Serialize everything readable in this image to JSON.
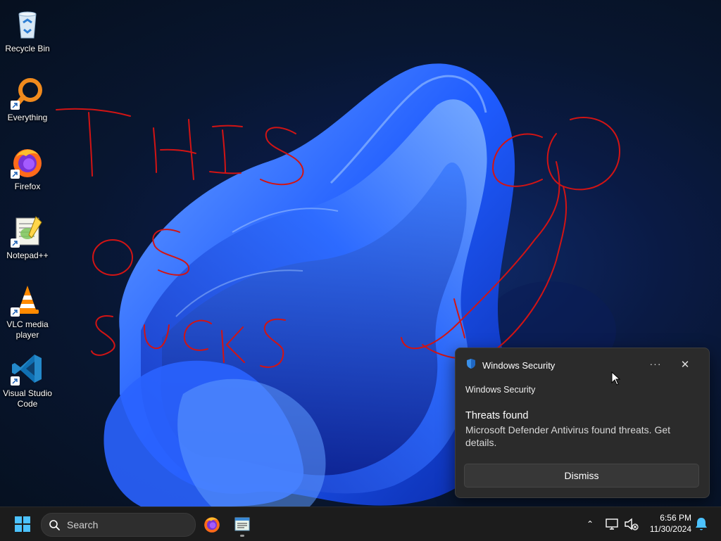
{
  "desktop": {
    "icons": [
      {
        "label": "Recycle Bin",
        "icon": "recycle-bin-icon"
      },
      {
        "label": "Everything",
        "icon": "everything-search-icon"
      },
      {
        "label": "Firefox",
        "icon": "firefox-icon"
      },
      {
        "label": "Notepad++",
        "icon": "notepad-plus-plus-icon"
      },
      {
        "label": "VLC media player",
        "icon": "vlc-icon"
      },
      {
        "label": "Visual Studio Code",
        "icon": "vscode-icon"
      }
    ],
    "scribble_text": [
      "THIS",
      "OS",
      "SUCKS"
    ],
    "scribble_color": "#d21414"
  },
  "toast": {
    "app_name": "Windows Security",
    "more_label": "···",
    "close_label": "✕",
    "source": "Windows Security",
    "title": "Threats found",
    "body": "Microsoft Defender Antivirus found threats. Get details.",
    "dismiss_label": "Dismiss"
  },
  "taskbar": {
    "search_placeholder": "Search",
    "pinned_apps": [
      "firefox-icon",
      "notepad-icon"
    ],
    "tray_chevron": "⌃",
    "clock_time": "6:56 PM",
    "clock_date": "11/30/2024"
  },
  "colors": {
    "accent": "#4cc2ff",
    "taskbar_bg": "#1c1c1c",
    "toast_bg": "#2b2b2b"
  }
}
